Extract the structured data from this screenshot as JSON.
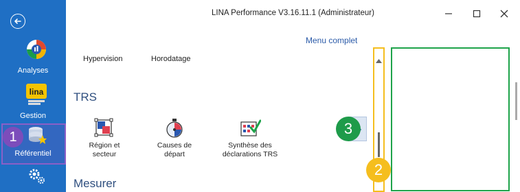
{
  "window": {
    "title": "LINA Performance  V3.16.11.1  (Administrateur)"
  },
  "sidebar": {
    "items": [
      {
        "label": "Analyses"
      },
      {
        "label": "Gestion"
      },
      {
        "label": "Référentiel"
      }
    ]
  },
  "content": {
    "menu_complet": "Menu complet",
    "tabs": [
      "Hypervision",
      "Horodatage"
    ],
    "sections": {
      "trs": "TRS",
      "mesurer": "Mesurer"
    },
    "tiles": [
      {
        "line1": "Région et",
        "line2": "secteur"
      },
      {
        "line1": "Causes de",
        "line2": "départ"
      },
      {
        "line1": "Synthèse des",
        "line2": "déclarations TRS"
      }
    ]
  },
  "annotations": {
    "badge1": "1",
    "badge2": "2",
    "badge3": "3"
  },
  "colors": {
    "sidebar": "#1f6fc4",
    "purple_highlight": "#8b5fc7",
    "yellow_highlight": "#f5be1e",
    "green_highlight": "#1ea34a"
  }
}
